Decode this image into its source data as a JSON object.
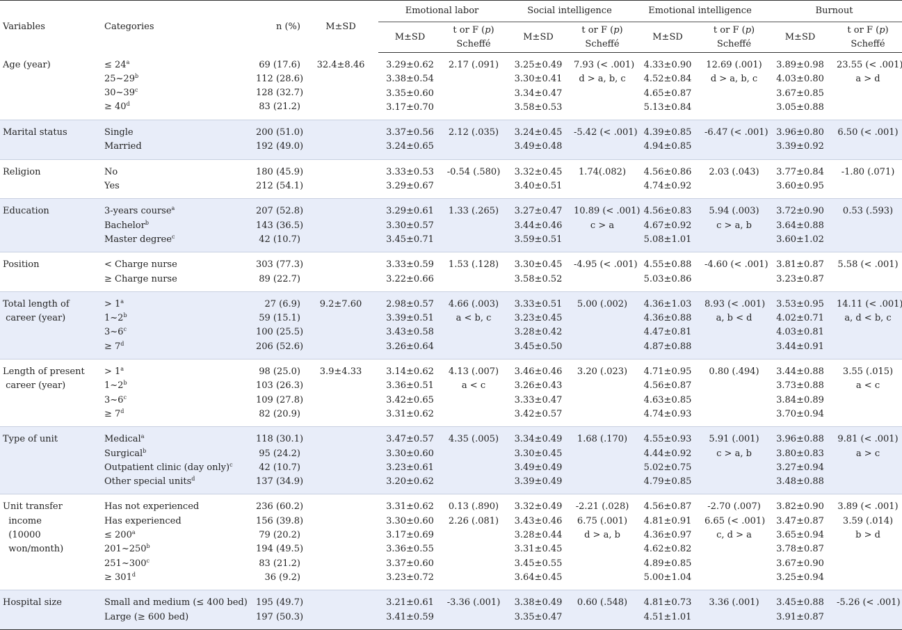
{
  "headers": {
    "variables": "Variables",
    "categories": "Categories",
    "n": "n (%)",
    "msd": "M±SD",
    "groups": [
      "Emotional labor",
      "Social intelligence",
      "Emotional intelligence",
      "Burnout"
    ],
    "sub_msd": "M±SD",
    "sub_test_a": "t or F (",
    "sub_test_p": "p",
    "sub_test_b": ")",
    "sub_test_c": "Scheffé"
  },
  "rows": [
    {
      "variable": [
        "Age (year)"
      ],
      "categories": [
        [
          "≤ 24",
          "a"
        ],
        [
          "25~29",
          "b"
        ],
        [
          "30~39",
          "c"
        ],
        [
          "≥ 40",
          "d"
        ]
      ],
      "n": [
        "69 (17.6)",
        "112 (28.6)",
        "128 (32.7)",
        "83 (21.2)"
      ],
      "msd": [
        "32.4±8.46"
      ],
      "el_m": [
        "3.29±0.62",
        "3.38±0.54",
        "3.35±0.60",
        "3.17±0.70"
      ],
      "el_t": [
        "2.17 (.091)"
      ],
      "si_m": [
        "3.25±0.49",
        "3.30±0.41",
        "3.34±0.47",
        "3.58±0.53"
      ],
      "si_t": [
        "7.93 (< .001)",
        "d > a, b, c"
      ],
      "ei_m": [
        "4.33±0.90",
        "4.52±0.84",
        "4.65±0.87",
        "5.13±0.84"
      ],
      "ei_t": [
        "12.69 (.001)",
        "d > a, b, c"
      ],
      "bo_m": [
        "3.89±0.98",
        "4.03±0.80",
        "3.67±0.85",
        "3.05±0.88"
      ],
      "bo_t": [
        "23.55 (< .001)",
        "a > d"
      ]
    },
    {
      "variable": [
        "Marital status"
      ],
      "categories": [
        [
          "Single",
          ""
        ],
        [
          "Married",
          ""
        ]
      ],
      "n": [
        "200 (51.0)",
        "192 (49.0)"
      ],
      "msd": [],
      "el_m": [
        "3.37±0.56",
        "3.24±0.65"
      ],
      "el_t": [
        "2.12 (.035)"
      ],
      "si_m": [
        "3.24±0.45",
        "3.49±0.48"
      ],
      "si_t": [
        "-5.42 (< .001)"
      ],
      "ei_m": [
        "4.39±0.85",
        "4.94±0.85"
      ],
      "ei_t": [
        "-6.47 (< .001)"
      ],
      "bo_m": [
        "3.96±0.80",
        "3.39±0.92"
      ],
      "bo_t": [
        "6.50 (< .001)"
      ]
    },
    {
      "variable": [
        "Religion"
      ],
      "categories": [
        [
          "No",
          ""
        ],
        [
          "Yes",
          ""
        ]
      ],
      "n": [
        "180 (45.9)",
        "212 (54.1)"
      ],
      "msd": [],
      "el_m": [
        "3.33±0.53",
        "3.29±0.67"
      ],
      "el_t": [
        "-0.54 (.580)"
      ],
      "si_m": [
        "3.32±0.45",
        "3.40±0.51"
      ],
      "si_t": [
        "1.74(.082)"
      ],
      "ei_m": [
        "4.56±0.86",
        "4.74±0.92"
      ],
      "ei_t": [
        "2.03 (.043)"
      ],
      "bo_m": [
        "3.77±0.84",
        "3.60±0.95"
      ],
      "bo_t": [
        "-1.80 (.071)"
      ]
    },
    {
      "variable": [
        "Education"
      ],
      "categories": [
        [
          "3-years course",
          "a"
        ],
        [
          "Bachelor",
          "b"
        ],
        [
          "Master degree",
          "c"
        ]
      ],
      "n": [
        "207 (52.8)",
        "143 (36.5)",
        "42 (10.7)"
      ],
      "msd": [],
      "el_m": [
        "3.29±0.61",
        "3.30±0.57",
        "3.45±0.71"
      ],
      "el_t": [
        "1.33 (.265)"
      ],
      "si_m": [
        "3.27±0.47",
        "3.44±0.46",
        "3.59±0.51"
      ],
      "si_t": [
        "10.89 (< .001)",
        "c > a"
      ],
      "ei_m": [
        "4.56±0.83",
        "4.67±0.92",
        "5.08±1.01"
      ],
      "ei_t": [
        "5.94 (.003)",
        "c > a, b"
      ],
      "bo_m": [
        "3.72±0.90",
        "3.64±0.88",
        "3.60±1.02"
      ],
      "bo_t": [
        "0.53 (.593)"
      ]
    },
    {
      "variable": [
        "Position"
      ],
      "categories": [
        [
          "< Charge nurse",
          ""
        ],
        [
          "≥ Charge nurse",
          ""
        ]
      ],
      "n": [
        "303 (77.3)",
        "89 (22.7)"
      ],
      "msd": [],
      "el_m": [
        "3.33±0.59",
        "3.22±0.66"
      ],
      "el_t": [
        "1.53 (.128)"
      ],
      "si_m": [
        "3.30±0.45",
        "3.58±0.52"
      ],
      "si_t": [
        "-4.95 (< .001)"
      ],
      "ei_m": [
        "4.55±0.88",
        "5.03±0.86"
      ],
      "ei_t": [
        "-4.60 (< .001)"
      ],
      "bo_m": [
        "3.81±0.87",
        "3.23±0.87"
      ],
      "bo_t": [
        "5.58 (< .001)"
      ]
    },
    {
      "variable": [
        "Total length of",
        " career (year)"
      ],
      "categories": [
        [
          "> 1",
          "a"
        ],
        [
          "1~2",
          "b"
        ],
        [
          "3~6",
          "c"
        ],
        [
          "≥ 7",
          "d"
        ]
      ],
      "n": [
        "27 (6.9)",
        "59 (15.1)",
        "100 (25.5)",
        "206 (52.6)"
      ],
      "msd": [
        "9.2±7.60"
      ],
      "el_m": [
        "2.98±0.57",
        "3.39±0.51",
        "3.43±0.58",
        "3.26±0.64"
      ],
      "el_t": [
        "4.66 (.003)",
        "a < b, c"
      ],
      "si_m": [
        "3.33±0.51",
        "3.23±0.45",
        "3.28±0.42",
        "3.45±0.50"
      ],
      "si_t": [
        "5.00 (.002)"
      ],
      "ei_m": [
        "4.36±1.03",
        "4.36±0.88",
        "4.47±0.81",
        "4.87±0.88"
      ],
      "ei_t": [
        "8.93 (< .001)",
        "a, b < d"
      ],
      "bo_m": [
        "3.53±0.95",
        "4.02±0.71",
        "4.03±0.81",
        "3.44±0.91"
      ],
      "bo_t": [
        "14.11 (< .001)",
        "a, d < b, c"
      ]
    },
    {
      "variable": [
        "Length of present",
        " career (year)"
      ],
      "categories": [
        [
          "> 1",
          "a"
        ],
        [
          "1~2",
          "b"
        ],
        [
          "3~6",
          "c"
        ],
        [
          "≥ 7",
          "d"
        ]
      ],
      "n": [
        "98 (25.0)",
        "103 (26.3)",
        "109 (27.8)",
        "82 (20.9)"
      ],
      "msd": [
        "3.9±4.33"
      ],
      "el_m": [
        "3.14±0.62",
        "3.36±0.51",
        "3.42±0.65",
        "3.31±0.62"
      ],
      "el_t": [
        "4.13 (.007)",
        "a < c"
      ],
      "si_m": [
        "3.46±0.46",
        "3.26±0.43",
        "3.33±0.47",
        "3.42±0.57"
      ],
      "si_t": [
        "3.20 (.023)"
      ],
      "ei_m": [
        "4.71±0.95",
        "4.56±0.87",
        "4.63±0.85",
        "4.74±0.93"
      ],
      "ei_t": [
        "0.80 (.494)"
      ],
      "bo_m": [
        "3.44±0.88",
        "3.73±0.88",
        "3.84±0.89",
        "3.70±0.94"
      ],
      "bo_t": [
        "3.55 (.015)",
        "a < c"
      ]
    },
    {
      "variable": [
        "Type of unit"
      ],
      "categories": [
        [
          "Medical",
          "a"
        ],
        [
          "Surgical",
          "b"
        ],
        [
          "Outpatient clinic (day only)",
          "c"
        ],
        [
          "Other special units",
          "d"
        ]
      ],
      "n": [
        "118 (30.1)",
        "95 (24.2)",
        "42 (10.7)",
        "137 (34.9)"
      ],
      "msd": [],
      "el_m": [
        "3.47±0.57",
        "3.30±0.60",
        "3.23±0.61",
        "3.20±0.62"
      ],
      "el_t": [
        "4.35 (.005)"
      ],
      "si_m": [
        "3.34±0.49",
        "3.30±0.45",
        "3.49±0.49",
        "3.39±0.49"
      ],
      "si_t": [
        "1.68 (.170)"
      ],
      "ei_m": [
        "4.55±0.93",
        "4.44±0.92",
        "5.02±0.75",
        "4.79±0.85"
      ],
      "ei_t": [
        "5.91 (.001)",
        "c > a, b"
      ],
      "bo_m": [
        "3.96±0.88",
        "3.80±0.83",
        "3.27±0.94",
        "3.48±0.88"
      ],
      "bo_t": [
        "9.81 (< .001)",
        "a > c"
      ]
    },
    {
      "variable": [
        "Unit transfer",
        "  income",
        "  (10000",
        "  won/month)"
      ],
      "categories": [
        [
          "Has not experienced",
          ""
        ],
        [
          "Has experienced",
          ""
        ],
        [
          "≤ 200",
          "a"
        ],
        [
          "201~250",
          "b"
        ],
        [
          "251~300",
          "c"
        ],
        [
          "≥ 301",
          "d"
        ]
      ],
      "n": [
        "236 (60.2)",
        "156 (39.8)",
        "79 (20.2)",
        "194 (49.5)",
        "83 (21.2)",
        "36 (9.2)"
      ],
      "msd": [],
      "el_m": [
        "3.31±0.62",
        "3.30±0.60",
        "3.17±0.69",
        "3.36±0.55",
        "3.37±0.60",
        "3.23±0.72"
      ],
      "el_t": [
        "0.13 (.890)",
        "2.26 (.081)"
      ],
      "si_m": [
        "3.32±0.49",
        "3.43±0.46",
        "3.28±0.44",
        "3.31±0.45",
        "3.45±0.55",
        "3.64±0.45"
      ],
      "si_t": [
        "-2.21 (.028)",
        "6.75 (.001)",
        "d > a, b"
      ],
      "ei_m": [
        "4.56±0.87",
        "4.81±0.91",
        "4.36±0.97",
        "4.62±0.82",
        "4.89±0.85",
        "5.00±1.04"
      ],
      "ei_t": [
        "-2.70 (.007)",
        "6.65 (< .001)",
        "c, d > a"
      ],
      "bo_m": [
        "3.82±0.90",
        "3.47±0.87",
        "3.65±0.94",
        "3.78±0.87",
        "3.67±0.90",
        "3.25±0.94"
      ],
      "bo_t": [
        "3.89 (< .001)",
        "3.59 (.014)",
        "b > d"
      ]
    },
    {
      "variable": [
        "Hospital size"
      ],
      "categories": [
        [
          "Small and medium (≤ 400 bed)",
          ""
        ],
        [
          "Large (≥ 600 bed)",
          ""
        ]
      ],
      "n": [
        "195 (49.7)",
        "197 (50.3)"
      ],
      "msd": [],
      "el_m": [
        "3.21±0.61",
        "3.41±0.59"
      ],
      "el_t": [
        "-3.36 (.001)"
      ],
      "si_m": [
        "3.38±0.49",
        "3.35±0.47"
      ],
      "si_t": [
        "0.60 (.548)"
      ],
      "ei_m": [
        "4.81±0.73",
        "4.51±1.01"
      ],
      "ei_t": [
        "3.36 (.001)"
      ],
      "bo_m": [
        "3.45±0.88",
        "3.91±0.87"
      ],
      "bo_t": [
        "-5.26 (< .001)"
      ]
    }
  ]
}
